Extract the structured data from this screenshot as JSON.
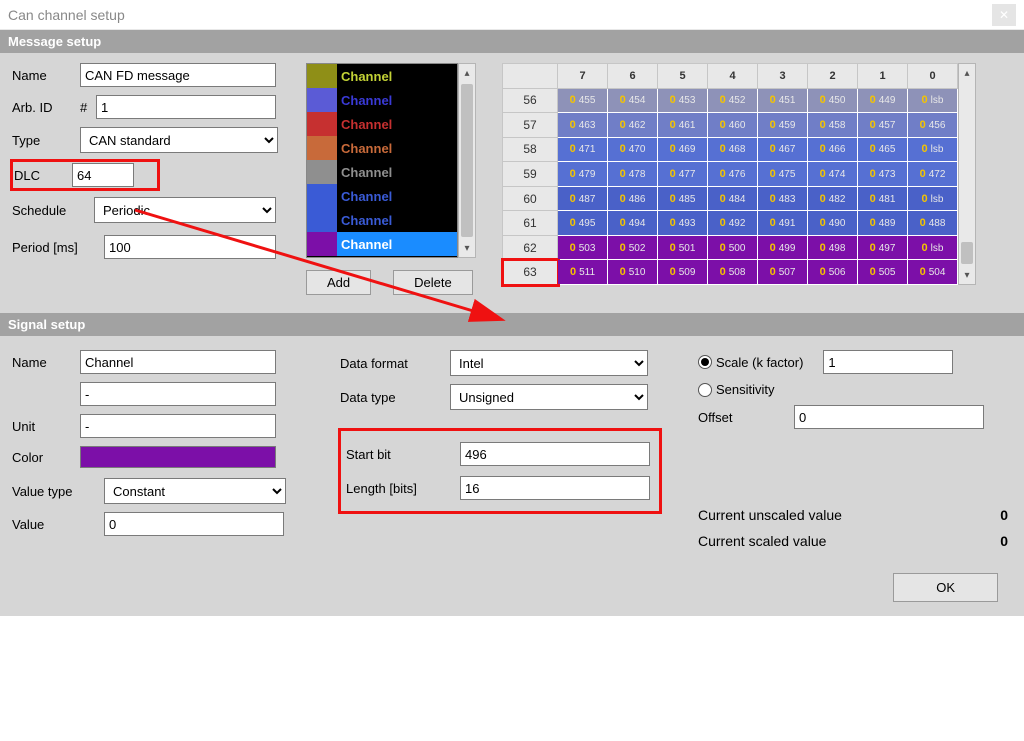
{
  "window": {
    "title": "Can channel setup"
  },
  "sections": {
    "message": "Message setup",
    "signal": "Signal setup"
  },
  "msg": {
    "name_lbl": "Name",
    "name": "CAN FD message",
    "arbid_lbl": "Arb. ID",
    "arbid_pfx": "#",
    "arbid": "1",
    "type_lbl": "Type",
    "type": "CAN standard",
    "dlc_lbl": "DLC",
    "dlc": "64",
    "sched_lbl": "Schedule",
    "sched": "Periodic",
    "period_lbl": "Period [ms]",
    "period": "100",
    "add_btn": "Add",
    "del_btn": "Delete"
  },
  "channels": [
    {
      "color": "#8f8f17",
      "text": "#c3d236",
      "label": "Channel",
      "sel": false
    },
    {
      "color": "#5b5bd6",
      "text": "#3a3ad6",
      "label": "Channel",
      "sel": false
    },
    {
      "color": "#c63030",
      "text": "#c63030",
      "label": "Channel",
      "sel": false
    },
    {
      "color": "#c86a3a",
      "text": "#c86a3a",
      "label": "Channel",
      "sel": false
    },
    {
      "color": "#8f8f8f",
      "text": "#8f8f8f",
      "label": "Channel",
      "sel": false
    },
    {
      "color": "#3a5bd6",
      "text": "#3a5bd6",
      "label": "Channel",
      "sel": false
    },
    {
      "color": "#3a5bd6",
      "text": "#3a5bd6",
      "label": "Channel",
      "sel": false
    },
    {
      "color": "#7c0fa8",
      "text": "#ffffff",
      "label": "Channel",
      "sel": true,
      "selbg": "#1a8cff"
    }
  ],
  "grid": {
    "cols": [
      "7",
      "6",
      "5",
      "4",
      "3",
      "2",
      "1",
      "0"
    ],
    "rows": [
      {
        "r": "56",
        "bg": "#8e92b8",
        "cells": [
          "455",
          "454",
          "453",
          "452",
          "451",
          "450",
          "449",
          "lsb"
        ]
      },
      {
        "r": "57",
        "bg": "#707ec7",
        "cells": [
          "463",
          "462",
          "461",
          "460",
          "459",
          "458",
          "457",
          "456"
        ]
      },
      {
        "r": "58",
        "bg": "#5670d3",
        "cells": [
          "471",
          "470",
          "469",
          "468",
          "467",
          "466",
          "465",
          "lsb"
        ]
      },
      {
        "r": "59",
        "bg": "#5670d3",
        "cells": [
          "479",
          "478",
          "477",
          "476",
          "475",
          "474",
          "473",
          "472"
        ]
      },
      {
        "r": "60",
        "bg": "#4a61c8",
        "cells": [
          "487",
          "486",
          "485",
          "484",
          "483",
          "482",
          "481",
          "lsb"
        ]
      },
      {
        "r": "61",
        "bg": "#4a61c8",
        "cells": [
          "495",
          "494",
          "493",
          "492",
          "491",
          "490",
          "489",
          "488"
        ]
      },
      {
        "r": "62",
        "bg": "#7c0fa8",
        "cells": [
          "503",
          "502",
          "501",
          "500",
          "499",
          "498",
          "497",
          "lsb"
        ]
      },
      {
        "r": "63",
        "bg": "#7c0fa8",
        "cells": [
          "511",
          "510",
          "509",
          "508",
          "507",
          "506",
          "505",
          "504"
        ]
      }
    ]
  },
  "sig": {
    "name_lbl": "Name",
    "name": "Channel",
    "name2": "-",
    "unit_lbl": "Unit",
    "unit": "-",
    "color_lbl": "Color",
    "color": "#7c0fa8",
    "vtype_lbl": "Value type",
    "vtype": "Constant",
    "value_lbl": "Value",
    "value": "0",
    "dfmt_lbl": "Data format",
    "dfmt": "Intel",
    "dtype_lbl": "Data type",
    "dtype": "Unsigned",
    "sbit_lbl": "Start bit",
    "sbit": "496",
    "len_lbl": "Length [bits]",
    "len": "16",
    "scale_lbl": "Scale (k factor)",
    "scale": "1",
    "sens_lbl": "Sensitivity",
    "offset_lbl": "Offset",
    "offset": "0",
    "cur_unscaled_lbl": "Current unscaled value",
    "cur_unscaled": "0",
    "cur_scaled_lbl": "Current scaled value",
    "cur_scaled": "0"
  },
  "ok": "OK"
}
